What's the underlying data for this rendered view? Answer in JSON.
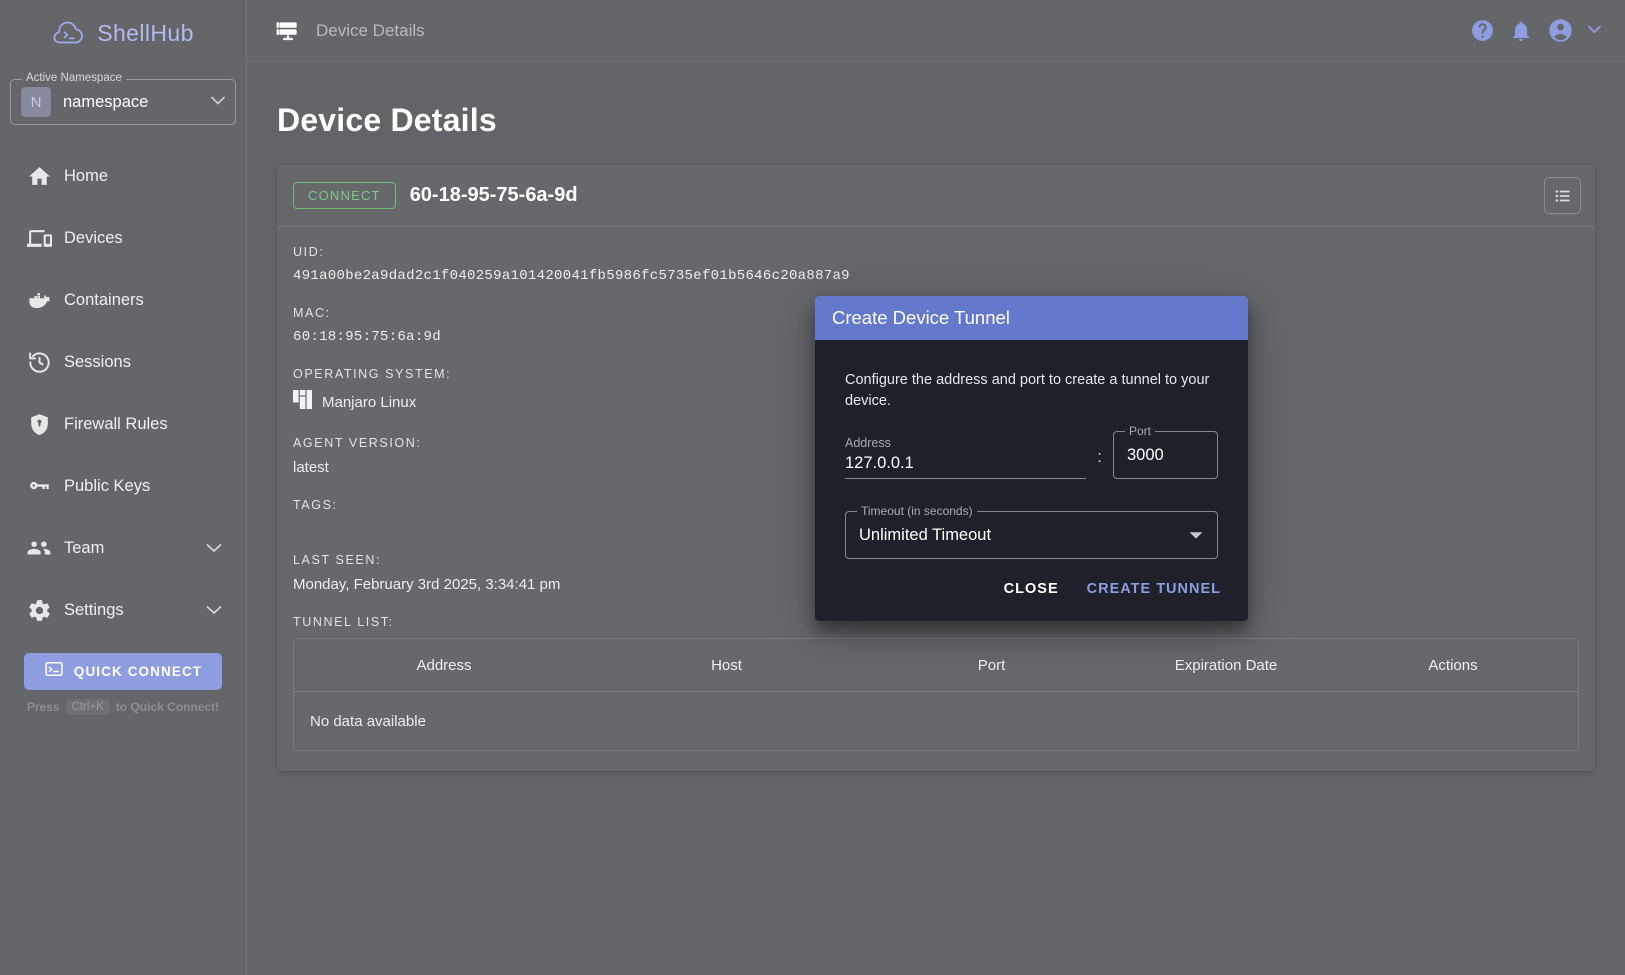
{
  "sidebar": {
    "brand": "ShellHub",
    "namespace": {
      "legend": "Active Namespace",
      "initial": "N",
      "name": "namespace"
    },
    "items": [
      {
        "label": "Home",
        "icon": "home-icon",
        "expandable": false
      },
      {
        "label": "Devices",
        "icon": "devices-icon",
        "expandable": false
      },
      {
        "label": "Containers",
        "icon": "container-icon",
        "expandable": false
      },
      {
        "label": "Sessions",
        "icon": "history-icon",
        "expandable": false
      },
      {
        "label": "Firewall Rules",
        "icon": "shield-icon",
        "expandable": false
      },
      {
        "label": "Public Keys",
        "icon": "key-icon",
        "expandable": false
      },
      {
        "label": "Team",
        "icon": "people-icon",
        "expandable": true
      },
      {
        "label": "Settings",
        "icon": "gear-icon",
        "expandable": true
      }
    ],
    "quick_connect": {
      "label": "QUICK CONNECT",
      "hint_prefix": "Press",
      "hint_key": "Ctrl+K",
      "hint_suffix": "to Quick Connect!"
    }
  },
  "topbar": {
    "title": "Device Details",
    "icons": [
      "help-icon",
      "notifications-icon",
      "account-icon",
      "chevron-down-icon"
    ]
  },
  "page": {
    "title": "Device Details"
  },
  "device_card": {
    "connect_label": "CONNECT",
    "name": "60-18-95-75-6a-9d",
    "list_button": "list-icon",
    "fields": [
      {
        "label": "UID:",
        "value": "491a00be2a9dad2c1f040259a101420041fb5986fc5735ef01b5646c20a887a9",
        "mono": true
      },
      {
        "label": "MAC:",
        "value": "60:18:95:75:6a:9d",
        "mono": true
      },
      {
        "label": "OPERATING SYSTEM:",
        "value": "Manjaro Linux",
        "mono": false
      },
      {
        "label": "AGENT VERSION:",
        "value": "latest",
        "mono": false
      },
      {
        "label": "TAGS:",
        "value": "",
        "mono": false
      },
      {
        "label": "LAST SEEN:",
        "value": "Monday, February 3rd 2025, 3:34:41 pm",
        "mono": false
      }
    ],
    "tunnel_list_label": "TUNNEL LIST:",
    "tunnel_table": {
      "headers": [
        "Address",
        "Host",
        "Port",
        "Expiration Date",
        "Actions"
      ],
      "empty_text": "No data available",
      "rows": []
    }
  },
  "modal": {
    "title": "Create Device Tunnel",
    "description": "Configure the address and port to create a tunnel to your device.",
    "address": {
      "label": "Address",
      "value": "127.0.0.1"
    },
    "separator": ":",
    "port": {
      "label": "Port",
      "value": "3000"
    },
    "timeout": {
      "label": "Timeout (in seconds)",
      "value": "Unlimited Timeout"
    },
    "close_label": "CLOSE",
    "create_label": "CREATE TUNNEL"
  },
  "colors": {
    "page_bg": "#636467",
    "sidebar_bg": "#65666a",
    "card_bg": "#67686c",
    "accent": "#8e9ce0",
    "modal_header": "#6478cc",
    "modal_bg": "#1e2129",
    "connect_green": "#81c784"
  }
}
